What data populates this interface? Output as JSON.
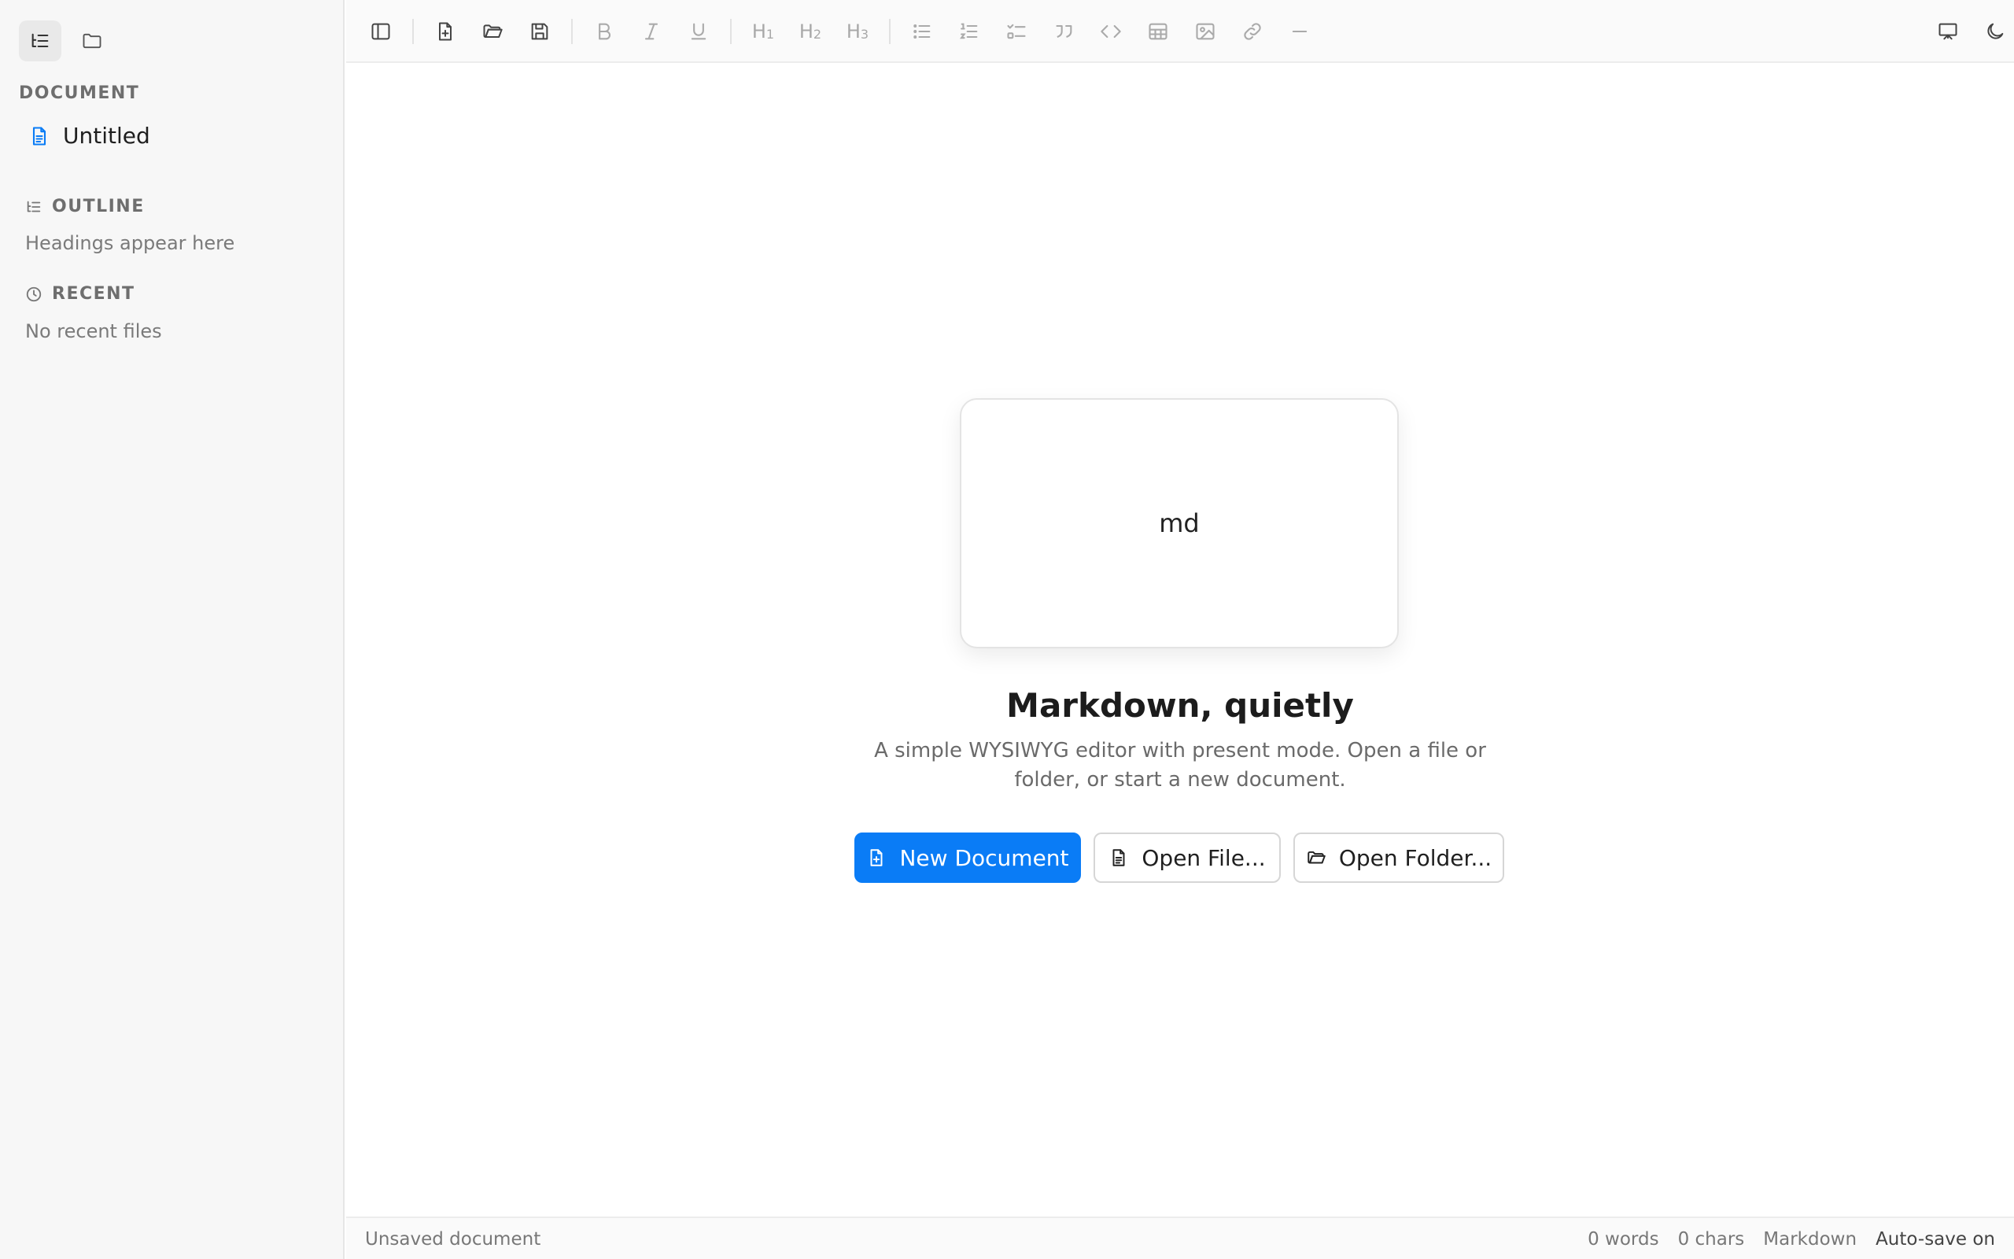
{
  "sidebar": {
    "tabs": [
      {
        "icon": "outline-list-icon",
        "active": true
      },
      {
        "icon": "folder-icon",
        "active": false
      }
    ],
    "document_heading": "DOCUMENT",
    "document_item": "Untitled",
    "outline_heading": "OUTLINE",
    "outline_empty": "Headings appear here",
    "recent_heading": "RECENT",
    "recent_empty": "No recent files"
  },
  "toolbar": {
    "h1_label": "H",
    "h1_sub": "1",
    "h2_label": "H",
    "h2_sub": "2",
    "h3_label": "H",
    "h3_sub": "3"
  },
  "main": {
    "card_text": "md",
    "title": "Markdown, quietly",
    "subtitle": "A simple WYSIWYG editor with present mode. Open a file or folder, or start a new document.",
    "new_document": "New Document",
    "open_file": "Open File...",
    "open_folder": "Open Folder..."
  },
  "status": {
    "left": "Unsaved document",
    "words": "0 words",
    "chars": "0 chars",
    "mode": "Markdown",
    "autosave": "Auto-save on"
  },
  "colors": {
    "accent": "#0a7cf6",
    "sidebar_bg": "#f7f7f7",
    "muted_text": "#7a7a7a"
  }
}
